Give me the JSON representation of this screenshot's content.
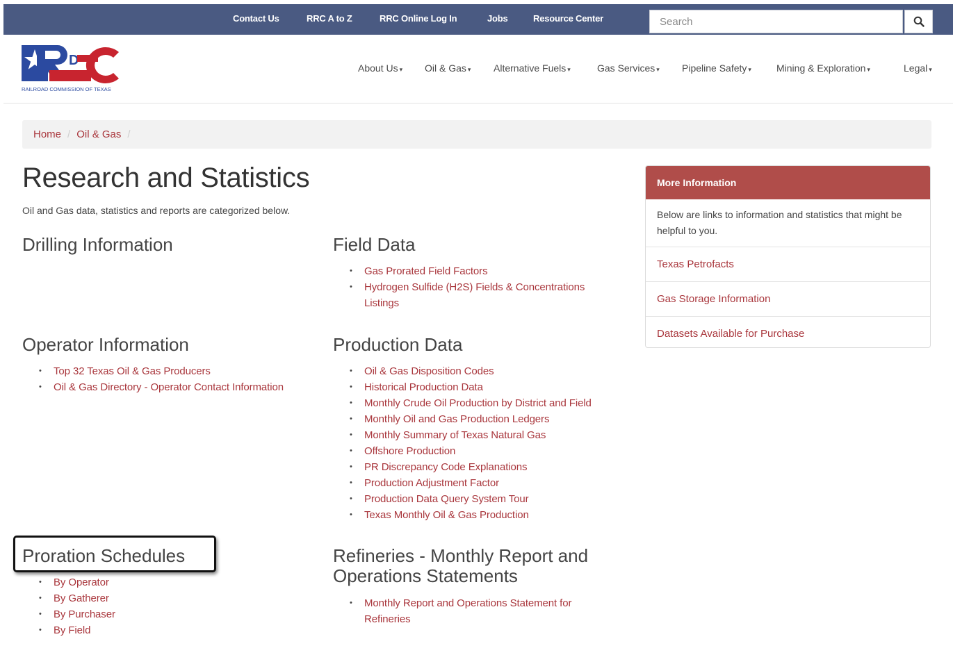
{
  "topbar": {
    "links": [
      "Contact Us",
      "RRC A to Z",
      "RRC Online Log In",
      "Jobs",
      "Resource Center"
    ],
    "search_placeholder": "Search"
  },
  "header": {
    "logo_text": "RAILROAD COMMISSION OF TEXAS",
    "nav": [
      "About Us",
      "Oil & Gas",
      "Alternative Fuels",
      "Gas Services",
      "Pipeline Safety",
      "Mining & Exploration",
      "Legal"
    ]
  },
  "breadcrumb": [
    "Home",
    "Oil & Gas"
  ],
  "page": {
    "title": "Research and Statistics",
    "intro": "Oil and Gas data, statistics and reports are categorized below."
  },
  "sections": {
    "drilling": {
      "title": "Drilling Information",
      "links": []
    },
    "field": {
      "title": "Field Data",
      "links": [
        "Gas Prorated Field Factors",
        "Hydrogen Sulfide (H2S) Fields & Concentrations Listings"
      ]
    },
    "operator": {
      "title": "Operator Information",
      "links": [
        "Top 32 Texas Oil & Gas Producers",
        "Oil & Gas Directory - Operator Contact Information"
      ]
    },
    "production": {
      "title": "Production Data",
      "links": [
        "Oil & Gas Disposition Codes",
        "Historical Production Data",
        "Monthly Crude Oil Production by District and Field",
        "Monthly Oil and Gas Production Ledgers",
        "Monthly Summary of Texas Natural Gas",
        "Offshore Production",
        "PR Discrepancy Code Explanations",
        "Production Adjustment Factor",
        "Production Data Query System Tour",
        "Texas Monthly Oil & Gas Production"
      ]
    },
    "proration": {
      "title": "Proration Schedules",
      "links": [
        "By Operator",
        "By Gatherer",
        "By Purchaser",
        "By Field"
      ]
    },
    "refineries": {
      "title": "Refineries - Monthly Report and Operations Statements",
      "links": [
        "Monthly Report and Operations Statement for Refineries"
      ]
    }
  },
  "sidebar": {
    "heading": "More Information",
    "description": "Below are links to information and statistics that might be helpful to you.",
    "links": [
      "Texas Petrofacts",
      "Gas Storage Information",
      "Datasets Available for Purchase"
    ]
  },
  "colors": {
    "topbar": "#4a5a82",
    "link": "#a9363c",
    "panel_header": "#b04d4a"
  }
}
